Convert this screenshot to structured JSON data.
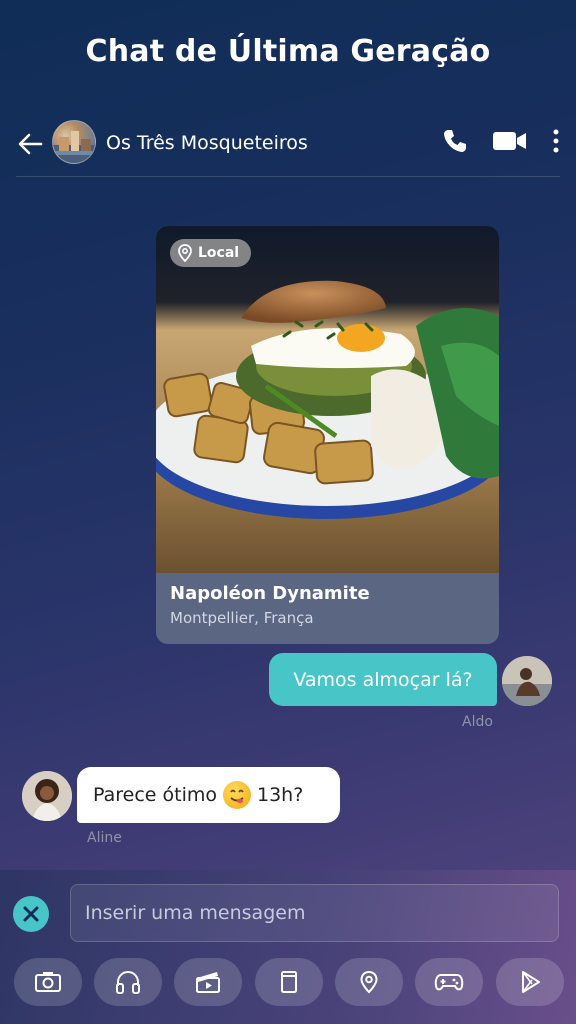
{
  "app_title": "Chat de Última Geração",
  "header": {
    "group_name": "Os Três Mosqueteiros"
  },
  "place_card": {
    "badge": "Local",
    "name": "Napoléon Dynamite",
    "location": "Montpellier, França"
  },
  "messages": [
    {
      "text": "Vamos almoçar lá?",
      "sender": "Aldo",
      "direction": "outgoing"
    },
    {
      "text_before": "Parece ótimo",
      "emoji": "yum",
      "text_after": "13h?",
      "sender": "Aline",
      "direction": "incoming"
    }
  ],
  "composer": {
    "placeholder": "Inserir uma mensagem"
  },
  "toolbar": [
    {
      "icon": "camera-icon"
    },
    {
      "icon": "headphones-icon"
    },
    {
      "icon": "clapperboard-icon"
    },
    {
      "icon": "document-icon"
    },
    {
      "icon": "location-pin-icon"
    },
    {
      "icon": "gamepad-icon"
    },
    {
      "icon": "play-store-icon"
    }
  ],
  "colors": {
    "accent": "#48c6c7",
    "incoming_bubble": "#ffffff"
  }
}
